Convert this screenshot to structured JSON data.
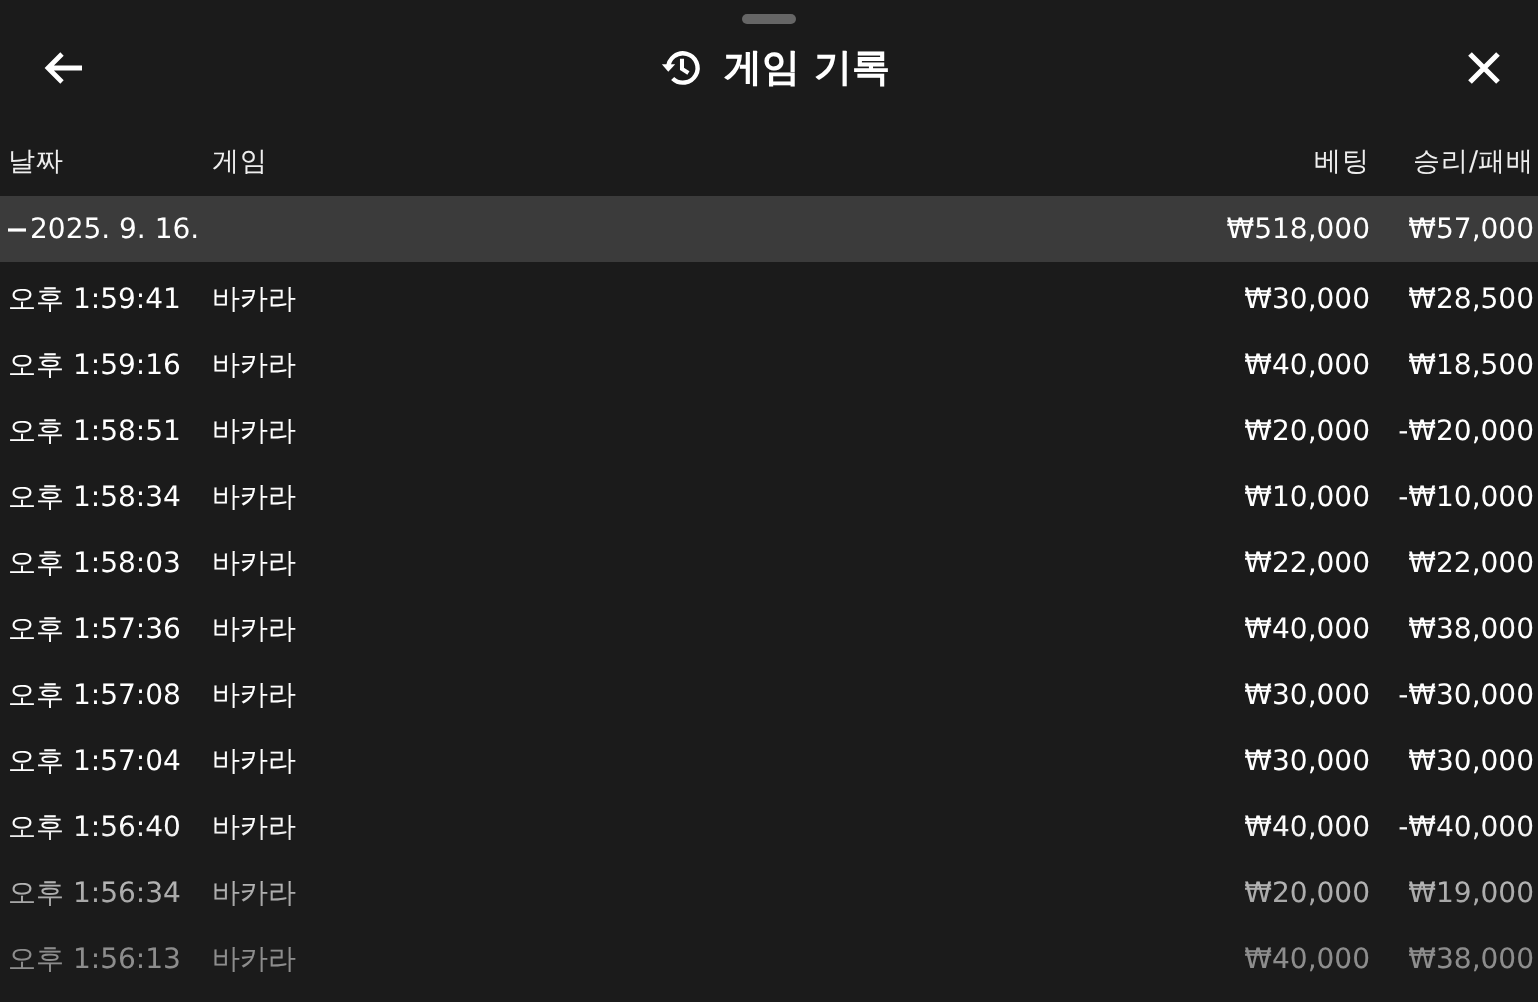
{
  "header": {
    "title": "게임 기록"
  },
  "columns": [
    "날짜",
    "게임",
    "베팅",
    "승리/패배"
  ],
  "groups": [
    {
      "date": "2025. 9. 16.",
      "expanded": true,
      "bet": "₩518,000",
      "result": "₩57,000",
      "rows": [
        {
          "time": "오후 1:59:41",
          "game": "바카라",
          "bet": "₩30,000",
          "result": "₩28,500"
        },
        {
          "time": "오후 1:59:16",
          "game": "바카라",
          "bet": "₩40,000",
          "result": "₩18,500"
        },
        {
          "time": "오후 1:58:51",
          "game": "바카라",
          "bet": "₩20,000",
          "result": "-₩20,000"
        },
        {
          "time": "오후 1:58:34",
          "game": "바카라",
          "bet": "₩10,000",
          "result": "-₩10,000"
        },
        {
          "time": "오후 1:58:03",
          "game": "바카라",
          "bet": "₩22,000",
          "result": "₩22,000"
        },
        {
          "time": "오후 1:57:36",
          "game": "바카라",
          "bet": "₩40,000",
          "result": "₩38,000"
        },
        {
          "time": "오후 1:57:08",
          "game": "바카라",
          "bet": "₩30,000",
          "result": "-₩30,000"
        },
        {
          "time": "오후 1:57:04",
          "game": "바카라",
          "bet": "₩30,000",
          "result": "₩30,000"
        },
        {
          "time": "오후 1:56:40",
          "game": "바카라",
          "bet": "₩40,000",
          "result": "-₩40,000"
        },
        {
          "time": "오후 1:56:34",
          "game": "바카라",
          "bet": "₩20,000",
          "result": "₩19,000"
        },
        {
          "time": "오후 1:56:13",
          "game": "바카라",
          "bet": "₩40,000",
          "result": "₩38,000"
        }
      ]
    }
  ]
}
